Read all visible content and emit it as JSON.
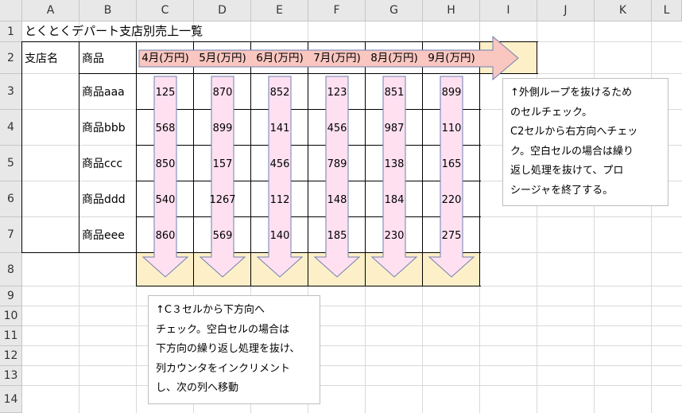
{
  "columns": [
    "A",
    "B",
    "C",
    "D",
    "E",
    "F",
    "G",
    "H",
    "I",
    "J",
    "K",
    "L"
  ],
  "rows": [
    "1",
    "2",
    "3",
    "4",
    "5",
    "6",
    "7",
    "8",
    "9",
    "10",
    "11",
    "12",
    "13",
    "14"
  ],
  "title": "とくとくデパート支店別売上一覧",
  "header": {
    "branch": "支店名",
    "product": "商品",
    "months": [
      "4月(万円)",
      "5月(万円)",
      "6月(万円)",
      "7月(万円)",
      "8月(万円)",
      "9月(万円)"
    ]
  },
  "table": {
    "products": [
      "商品aaa",
      "商品bbb",
      "商品ccc",
      "商品ddd",
      "商品eee"
    ],
    "values": [
      [
        "125",
        "870",
        "852",
        "123",
        "851",
        "899"
      ],
      [
        "568",
        "899",
        "141",
        "456",
        "987",
        "110"
      ],
      [
        "850",
        "157",
        "456",
        "789",
        "138",
        "165"
      ],
      [
        "540",
        "1267",
        "112",
        "148",
        "184",
        "220"
      ],
      [
        "860",
        "569",
        "140",
        "185",
        "230",
        "275"
      ]
    ]
  },
  "note_right": [
    "↑外側ループを抜けるため",
    "のセルチェック。",
    "C2セルから右方向へチェッ",
    "ク。空白セルの場合は繰り",
    "返し処理を抜けて、プロ",
    "シージャを終了する。"
  ],
  "note_bottom": [
    "↑C３セルから下方向へ",
    "チェック。空白セルの場合は",
    "下方向の繰り返し処理を抜け、",
    "列カウンタをインクリメント",
    "し、次の列へ移動"
  ],
  "colors": {
    "arrow_fill": "#ffe0f0",
    "arrow_right_fill": "#f9c6c0",
    "arrow_stroke": "#6f7fb0",
    "check_cell_fill": "#fdf0c8"
  }
}
